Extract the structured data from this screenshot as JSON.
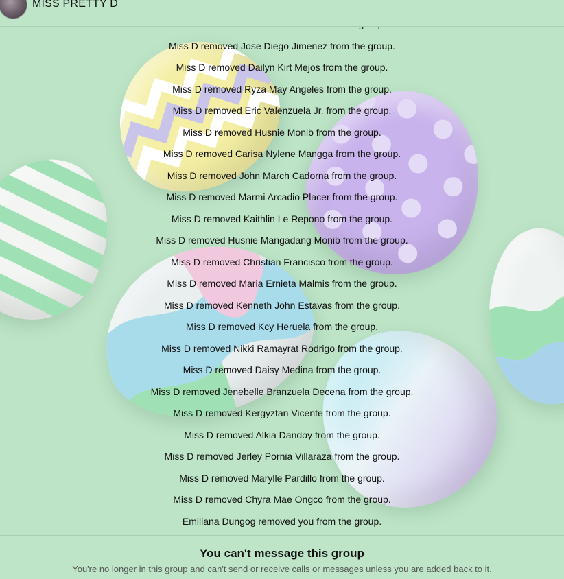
{
  "header": {
    "group_name": "MISS PRETTY D"
  },
  "messages": [
    "Miss D removed Cica Fernandez from the group.",
    "Miss D removed Jose Diego Jimenez from the group.",
    "Miss D removed Dailyn Kirt Mejos from the group.",
    "Miss D removed Ryza May Angeles from the group.",
    "Miss D removed Eric Valenzuela Jr. from the group.",
    "Miss D removed Husnie Monib from the group.",
    "Miss D removed Carisa Nylene Mangga from the group.",
    "Miss D removed John March Cadorna from the group.",
    "Miss D removed Marmi Arcadio Placer from the group.",
    "Miss D removed Kaithlin Le Repono from the group.",
    "Miss D removed Husnie Mangadang Monib from the group.",
    "Miss D removed Christian Francisco from the group.",
    "Miss D removed Maria Ernieta Malmis from the group.",
    "Miss D removed Kenneth John Estavas from the group.",
    "Miss D removed Kcy Heruela from the group.",
    "Miss D removed Nikki Ramayrat Rodrigo from the group.",
    "Miss D removed Daisy Medina from the group.",
    "Miss D removed Jenebelle Branzuela Decena from the group.",
    "Miss D removed Kergyztan Vicente from the group.",
    "Miss D removed Alkia Dandoy from the group.",
    "Miss D removed Jerley Pornia Villaraza from the group.",
    "Miss D removed Marylle Pardillo from the group.",
    "Miss D removed Chyra Mae Ongco from the group.",
    "Emiliana Dungog removed you from the group."
  ],
  "footer": {
    "title": "You can't message this group",
    "subtitle": "You're no longer in this group and can't send or receive calls or messages unless you are added back to it."
  },
  "theme": {
    "background": "#bde4c7",
    "text": "#111111",
    "muted_text": "#555555"
  }
}
